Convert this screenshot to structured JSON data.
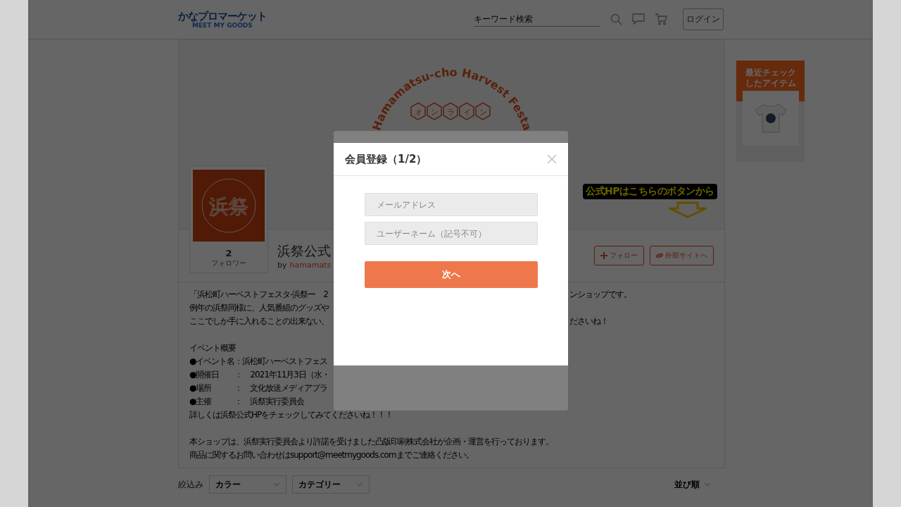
{
  "header": {
    "logo": "かなプロマーケット",
    "logo_sub": "MEET MY GOODS",
    "search": {
      "placeholder": "キーワード検索"
    },
    "login": "ログイン"
  },
  "banner": {
    "arc_text": "Hamamatsu-cho Harvest Festa",
    "hex_chars": [
      "オ",
      "ン",
      "ラ",
      "イ",
      "ン"
    ],
    "callout": "公式HPはこちらのボタンから"
  },
  "shop": {
    "avatar_text": "浜祭",
    "followers": "2",
    "followers_label": "フォロワー",
    "name": "浜祭公式",
    "by": "by",
    "owner": "hamamats",
    "follow": "フォロー",
    "external": "外部サイトへ"
  },
  "description": [
    {
      "kind": "text",
      "left": "「浜松町ハーベストフェスタ-浜祭ー　2",
      "right": "ンショップです。"
    },
    {
      "kind": "text",
      "left": "例年の浜祭同様に、人気番組のグッズや"
    },
    {
      "kind": "text",
      "left": "ここでしか手に入れることの出来ない、",
      "right": "ださいね！"
    },
    {
      "kind": "blank"
    },
    {
      "kind": "text",
      "left": "イベント概要"
    },
    {
      "kind": "text",
      "left": "●イベント名：浜松町ハーベストフェス"
    },
    {
      "kind": "text",
      "left": "●開催日　　：　2021年11月3日（水・"
    },
    {
      "kind": "text",
      "left": "●場所　　　：　文化放送メディアプラ"
    },
    {
      "kind": "text",
      "left": "●主催　　　：　浜祭実行委員会"
    },
    {
      "kind": "text",
      "left": "詳しくは浜祭公式HPをチェックしてみてくださいね！！！"
    },
    {
      "kind": "blank"
    },
    {
      "kind": "text",
      "left": "本ショップは、浜祭実行委員会より許諾を受けました凸版印刷株式会社が企画・運営を行っております。"
    },
    {
      "kind": "text",
      "left": "商品に関するお問い合わせはsupport@meetmygoods.comまでご連絡ください。"
    }
  ],
  "filters": {
    "label": "絞込み",
    "dropdowns": [
      "カラー",
      "カテゴリー"
    ],
    "sort": "並び順"
  },
  "recent": {
    "title": "最近チェックしたアイテム"
  },
  "modal": {
    "title": "会員登録（1/2）",
    "fields": [
      {
        "placeholder": "メールアドレス"
      },
      {
        "placeholder": "ユーザーネーム（記号不可）"
      }
    ],
    "submit": "次へ"
  }
}
